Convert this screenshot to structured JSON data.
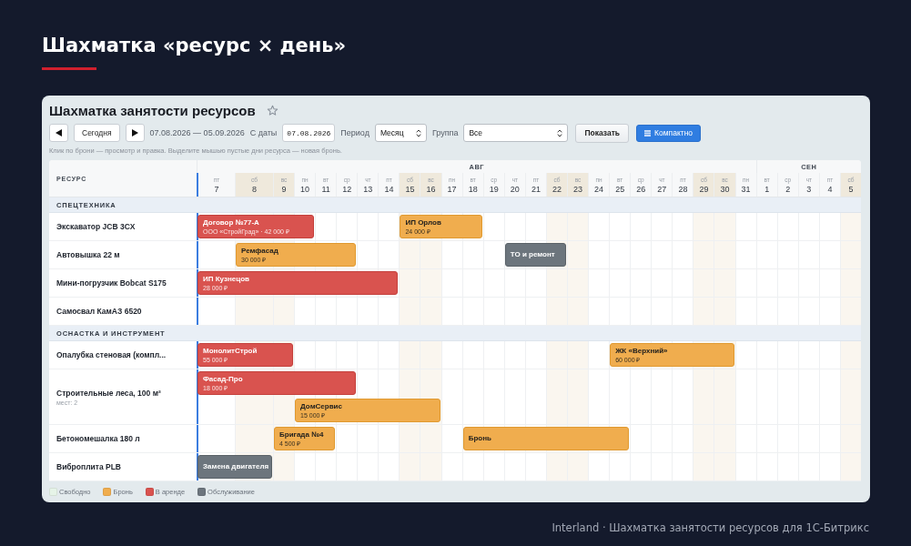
{
  "page_title": "Шахматка «ресурс × день»",
  "panel": {
    "title": "Шахматка занятости ресурсов",
    "toolbar": {
      "today_button": "Сегодня",
      "range": "07.08.2026 — 05.09.2026",
      "date_label": "С даты",
      "date_value": "07.08.2026",
      "period_label": "Период",
      "period_value": "Месяц",
      "group_label": "Группа",
      "group_value": "Все",
      "show_button": "Показать",
      "compact_button": "Компактно"
    },
    "hint": "Клик по брони — просмотр и правка. Выделите мышью пустые дни ресурса — новая бронь.",
    "resource_heading": "РЕСУРС",
    "months": [
      {
        "label": "АВГ",
        "days": [
          {
            "weekday": "пт",
            "date": "7",
            "weekend": false,
            "today": true
          },
          {
            "weekday": "сб",
            "date": "8",
            "weekend": true,
            "today": false
          },
          {
            "weekday": "вс",
            "date": "9",
            "weekend": true,
            "today": false
          },
          {
            "weekday": "пн",
            "date": "10",
            "weekend": false,
            "today": false
          },
          {
            "weekday": "вт",
            "date": "11",
            "weekend": false,
            "today": false
          },
          {
            "weekday": "ср",
            "date": "12",
            "weekend": false,
            "today": false
          },
          {
            "weekday": "чт",
            "date": "13",
            "weekend": false,
            "today": false
          },
          {
            "weekday": "пт",
            "date": "14",
            "weekend": false,
            "today": false
          },
          {
            "weekday": "сб",
            "date": "15",
            "weekend": true,
            "today": false
          },
          {
            "weekday": "вс",
            "date": "16",
            "weekend": true,
            "today": false
          },
          {
            "weekday": "пн",
            "date": "17",
            "weekend": false,
            "today": false
          },
          {
            "weekday": "вт",
            "date": "18",
            "weekend": false,
            "today": false
          },
          {
            "weekday": "ср",
            "date": "19",
            "weekend": false,
            "today": false
          },
          {
            "weekday": "чт",
            "date": "20",
            "weekend": false,
            "today": false
          },
          {
            "weekday": "пт",
            "date": "21",
            "weekend": false,
            "today": false
          },
          {
            "weekday": "сб",
            "date": "22",
            "weekend": true,
            "today": false
          },
          {
            "weekday": "вс",
            "date": "23",
            "weekend": true,
            "today": false
          },
          {
            "weekday": "пн",
            "date": "24",
            "weekend": false,
            "today": false
          },
          {
            "weekday": "вт",
            "date": "25",
            "weekend": false,
            "today": false
          },
          {
            "weekday": "ср",
            "date": "26",
            "weekend": false,
            "today": false
          },
          {
            "weekday": "чт",
            "date": "27",
            "weekend": false,
            "today": false
          },
          {
            "weekday": "пт",
            "date": "28",
            "weekend": false,
            "today": false
          },
          {
            "weekday": "сб",
            "date": "29",
            "weekend": true,
            "today": false
          },
          {
            "weekday": "вс",
            "date": "30",
            "weekend": true,
            "today": false
          },
          {
            "weekday": "пн",
            "date": "31",
            "weekend": false,
            "today": false
          }
        ]
      },
      {
        "label": "СЕН",
        "days": [
          {
            "weekday": "вт",
            "date": "1",
            "weekend": false,
            "today": false
          },
          {
            "weekday": "ср",
            "date": "2",
            "weekend": false,
            "today": false
          },
          {
            "weekday": "чт",
            "date": "3",
            "weekend": false,
            "today": false
          },
          {
            "weekday": "пт",
            "date": "4",
            "weekend": false,
            "today": false
          },
          {
            "weekday": "сб",
            "date": "5",
            "weekend": true,
            "today": false
          }
        ]
      }
    ],
    "groups": [
      {
        "label": "СПЕЦТЕХНИКА",
        "resources": [
          {
            "name": "Экскаватор JCB 3CX",
            "lanes": [
              [
                {
                  "kind": "rent",
                  "title": "Договор №77-А",
                  "detail": "ООО «СтройГрад» · 42 000 ₽"
                },
                {
                  "kind": "cont"
                },
                {
                  "kind": "cont"
                },
                {
                  "kind": "cont"
                },
                {
                  "kind": "free"
                },
                {
                  "kind": "free"
                },
                {
                  "kind": "free"
                },
                {
                  "kind": "free"
                },
                {
                  "kind": "booked",
                  "title": "ИП Орлов",
                  "detail": "24 000 ₽"
                },
                {
                  "kind": "cont"
                },
                {
                  "kind": "cont"
                },
                {
                  "kind": "cont"
                }
              ]
            ]
          },
          {
            "name": "Автовышка 22 м",
            "lanes": [
              [
                {
                  "kind": "free"
                },
                {
                  "kind": "booked",
                  "title": "Ремфасад",
                  "detail": "30 000 ₽"
                },
                {
                  "kind": "cont"
                },
                {
                  "kind": "cont"
                },
                {
                  "kind": "cont"
                },
                {
                  "kind": "cont"
                },
                {
                  "kind": "free"
                },
                {
                  "kind": "free"
                },
                {
                  "kind": "free"
                },
                {
                  "kind": "free"
                },
                {
                  "kind": "free"
                },
                {
                  "kind": "free"
                },
                {
                  "kind": "free"
                },
                {
                  "kind": "service",
                  "title": "ТО и ремонт"
                },
                {
                  "kind": "cont"
                },
                {
                  "kind": "cont"
                }
              ]
            ]
          },
          {
            "name": "Мини-погрузчик Bobcat S175",
            "lanes": [
              [
                {
                  "kind": "rent",
                  "title": "ИП Кузнецов",
                  "detail": "28 000 ₽"
                },
                {
                  "kind": "cont"
                },
                {
                  "kind": "cont"
                },
                {
                  "kind": "cont"
                },
                {
                  "kind": "cont"
                },
                {
                  "kind": "cont"
                },
                {
                  "kind": "cont"
                },
                {
                  "kind": "cont"
                }
              ]
            ]
          },
          {
            "name": "Самосвал КамАЗ 6520"
          }
        ]
      },
      {
        "label": "ОСНАСТКА И ИНСТРУМЕНТ",
        "resources": [
          {
            "name": "Опалубка стеновая (компл...",
            "lanes": [
              [
                {
                  "kind": "rent",
                  "title": "МонолитСтрой",
                  "detail": "55 000 ₽"
                },
                {
                  "kind": "cont"
                },
                {
                  "kind": "cont"
                },
                {
                  "kind": "free"
                },
                {
                  "kind": "free"
                },
                {
                  "kind": "free"
                },
                {
                  "kind": "free"
                },
                {
                  "kind": "free"
                },
                {
                  "kind": "free"
                },
                {
                  "kind": "free"
                },
                {
                  "kind": "free"
                },
                {
                  "kind": "free"
                },
                {
                  "kind": "free"
                },
                {
                  "kind": "free"
                },
                {
                  "kind": "free"
                },
                {
                  "kind": "free"
                },
                {
                  "kind": "free"
                },
                {
                  "kind": "free"
                },
                {
                  "kind": "booked",
                  "title": "ЖК «Верхний»",
                  "detail": "60 000 ₽"
                },
                {
                  "kind": "cont"
                },
                {
                  "kind": "cont"
                },
                {
                  "kind": "cont"
                },
                {
                  "kind": "cont"
                },
                {
                  "kind": "cont"
                }
              ]
            ]
          },
          {
            "name": "Строительные леса, 100 м²",
            "meta": "мест: 2",
            "lanes": [
              [
                {
                  "kind": "rent",
                  "title": "Фасад-Про",
                  "detail": "18 000 ₽"
                },
                {
                  "kind": "cont"
                },
                {
                  "kind": "cont"
                },
                {
                  "kind": "cont"
                },
                {
                  "kind": "cont"
                },
                {
                  "kind": "cont"
                }
              ],
              [
                {
                  "kind": "free"
                },
                {
                  "kind": "free"
                },
                {
                  "kind": "free"
                },
                {
                  "kind": "booked",
                  "title": "ДомСервис",
                  "detail": "15 000 ₽"
                },
                {
                  "kind": "cont"
                },
                {
                  "kind": "cont"
                },
                {
                  "kind": "cont"
                },
                {
                  "kind": "cont"
                },
                {
                  "kind": "cont"
                },
                {
                  "kind": "cont"
                }
              ]
            ]
          },
          {
            "name": "Бетономешалка 180 л",
            "lanes": [
              [
                {
                  "kind": "free"
                },
                {
                  "kind": "free"
                },
                {
                  "kind": "booked",
                  "title": "Бригада №4",
                  "detail": "4 500 ₽"
                },
                {
                  "kind": "cont"
                },
                {
                  "kind": "cont"
                },
                {
                  "kind": "free"
                },
                {
                  "kind": "free"
                },
                {
                  "kind": "free"
                },
                {
                  "kind": "free"
                },
                {
                  "kind": "free"
                },
                {
                  "kind": "free"
                },
                {
                  "kind": "booked",
                  "title": "Бронь"
                },
                {
                  "kind": "cont"
                },
                {
                  "kind": "cont"
                },
                {
                  "kind": "cont"
                },
                {
                  "kind": "cont"
                },
                {
                  "kind": "cont"
                },
                {
                  "kind": "cont"
                },
                {
                  "kind": "cont"
                }
              ]
            ]
          },
          {
            "name": "Виброплита PLB",
            "lanes": [
              [
                {
                  "kind": "service",
                  "title": "Замена двигателя"
                },
                {
                  "kind": "cont"
                }
              ]
            ]
          }
        ]
      }
    ],
    "legend": [
      {
        "label": "Свободно",
        "color": "#e6f4e8"
      },
      {
        "label": "Бронь",
        "color": "#f0ad4e"
      },
      {
        "label": "В аренде",
        "color": "#d9534f"
      },
      {
        "label": "Обслуживание",
        "color": "#6c757d"
      }
    ]
  },
  "footer": "Interland · Шахматка занятости ресурсов для 1С-Битрикс"
}
